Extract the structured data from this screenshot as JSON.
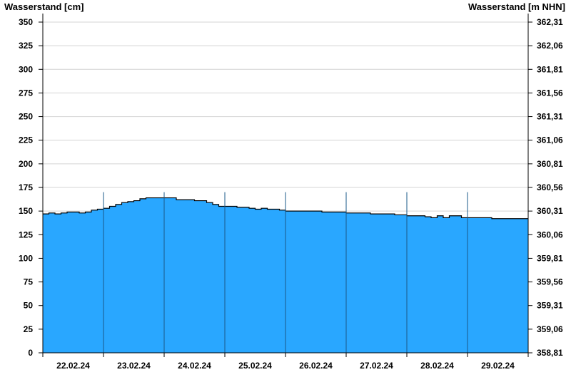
{
  "chart_data": {
    "type": "area",
    "left_axis_title": "Wasserstand [cm]",
    "right_axis_title": "Wasserstand [m NHN]",
    "ylim": [
      0,
      360
    ],
    "y_ticks": [
      0,
      25,
      50,
      75,
      100,
      125,
      150,
      175,
      200,
      225,
      250,
      275,
      300,
      325,
      350
    ],
    "right_ticks": [
      {
        "at": 0,
        "label": "358,81"
      },
      {
        "at": 25,
        "label": "359,06"
      },
      {
        "at": 50,
        "label": "359,31"
      },
      {
        "at": 75,
        "label": "359,56"
      },
      {
        "at": 100,
        "label": "359,81"
      },
      {
        "at": 125,
        "label": "360,06"
      },
      {
        "at": 150,
        "label": "360,31"
      },
      {
        "at": 175,
        "label": "360,56"
      },
      {
        "at": 200,
        "label": "360,81"
      },
      {
        "at": 225,
        "label": "361,06"
      },
      {
        "at": 250,
        "label": "361,31"
      },
      {
        "at": 275,
        "label": "361,56"
      },
      {
        "at": 300,
        "label": "361,81"
      },
      {
        "at": 325,
        "label": "362,06"
      },
      {
        "at": 350,
        "label": "362,31"
      }
    ],
    "xlim": [
      0,
      8
    ],
    "x_labels": [
      "22.02.24",
      "23.02.24",
      "24.02.24",
      "25.02.24",
      "26.02.24",
      "27.02.24",
      "28.02.24",
      "29.02.24"
    ],
    "grid": true,
    "fill_color": "#29a7ff",
    "series": [
      {
        "x": [
          0,
          0.1,
          0.2,
          0.3,
          0.4,
          0.5,
          0.6,
          0.7,
          0.8,
          0.9,
          1.0,
          1.1,
          1.2,
          1.3,
          1.4,
          1.5,
          1.6,
          1.7,
          1.8,
          1.9,
          2.0,
          2.1,
          2.2,
          2.3,
          2.4,
          2.5,
          2.6,
          2.7,
          2.8,
          2.9,
          3.0,
          3.1,
          3.2,
          3.3,
          3.4,
          3.5,
          3.6,
          3.7,
          3.8,
          3.9,
          4.0,
          4.2,
          4.4,
          4.6,
          4.8,
          5.0,
          5.2,
          5.4,
          5.6,
          5.8,
          6.0,
          6.1,
          6.2,
          6.3,
          6.4,
          6.5,
          6.6,
          6.7,
          6.8,
          6.9,
          7.0,
          7.2,
          7.4,
          7.6,
          7.8,
          8.0
        ],
        "values": [
          147,
          148,
          147,
          148,
          149,
          149,
          148,
          149,
          151,
          152,
          153,
          155,
          157,
          159,
          160,
          161,
          163,
          164,
          164,
          164,
          164,
          164,
          162,
          162,
          162,
          161,
          161,
          159,
          157,
          155,
          155,
          155,
          154,
          154,
          153,
          152,
          153,
          152,
          152,
          151,
          150,
          150,
          150,
          149,
          149,
          148,
          148,
          147,
          147,
          146,
          145,
          145,
          145,
          144,
          143,
          145,
          143,
          145,
          145,
          143,
          143,
          143,
          142,
          142,
          142,
          142
        ]
      }
    ]
  }
}
